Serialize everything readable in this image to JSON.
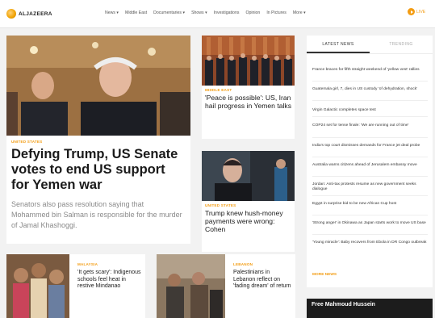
{
  "header": {
    "logo_text": "ALJAZEERA",
    "nav": [
      "News ▾",
      "Middle East",
      "Documentaries ▾",
      "Shows ▾",
      "Investigations",
      "Opinion",
      "In Pictures",
      "More ▾"
    ],
    "live_label": "LIVE"
  },
  "lead": {
    "kicker": "UNITED STATES",
    "title": "Defying Trump, US Senate votes to end US support for Yemen war",
    "summary": "Senators also pass resolution saying that Mohammed bin Salman is responsible for the murder of Jamal Khashoggi."
  },
  "stories": [
    {
      "kicker": "MIDDLE EAST",
      "title": "'Peace is possible': US, Iran hail progress in Yemen talks"
    },
    {
      "kicker": "UNITED STATES",
      "title": "Trump knew hush-money payments were wrong: Cohen"
    }
  ],
  "bottom": [
    {
      "kicker": "MALAYSIA",
      "title": "'It gets scary': Indigenous schools feel heat in restive Mindanao"
    },
    {
      "kicker": "LEBANON",
      "title": "Palestinians in Lebanon reflect on 'fading dream' of return"
    }
  ],
  "latest": {
    "tab_latest": "LATEST NEWS",
    "tab_trending": "TRENDING",
    "items": [
      "France braces for fifth straight weekend of 'yellow vest' rallies",
      "Guatemala girl, 7, dies in US custody 'of dehydration, shock'",
      "Virgin Galactic completes space test",
      "COP24 set for tense finale: 'We are running out of time'",
      "India's top court dismisses demands for France jet deal probe",
      "Australia warns citizens ahead of Jerusalem embassy move",
      "Jordan: Anti-tax protests resume as new government seeks dialogue",
      "Egypt in surprise bid to be new African Cup host",
      "'Strong anger' in Okinawa as Japan starts work to move US base",
      "'Young miracle': Baby recovers from Ebola in DR Congo outbreak"
    ],
    "more_label": "MORE NEWS"
  },
  "banner": {
    "title": "Free Mahmoud Hussein"
  }
}
